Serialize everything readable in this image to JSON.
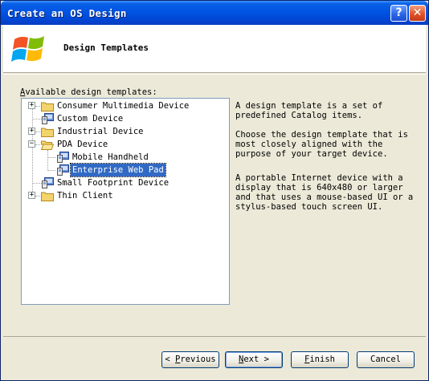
{
  "window": {
    "title": "Create an OS Design",
    "help_glyph": "?",
    "close_glyph": "✕"
  },
  "header": {
    "title": "Design Templates",
    "logo_icon": "windows-flag-icon"
  },
  "templates_label": {
    "accel": "A",
    "rest": "vailable design templates:"
  },
  "tree": {
    "items": [
      {
        "label": "Consumer Multimedia Device",
        "expander": "+",
        "icon": "folder-icon"
      },
      {
        "label": "Custom Device",
        "icon": "device-icon"
      },
      {
        "label": "Industrial Device",
        "expander": "+",
        "icon": "folder-icon"
      },
      {
        "label": "PDA Device",
        "expander": "−",
        "icon": "folder-open-icon"
      },
      {
        "label": "Mobile Handheld",
        "icon": "device-icon"
      },
      {
        "label": "Enterprise Web Pad",
        "icon": "device-icon",
        "selected": true
      },
      {
        "label": "Small Footprint Device",
        "icon": "device-icon"
      },
      {
        "label": "Thin Client",
        "expander": "+",
        "icon": "folder-icon"
      }
    ]
  },
  "description": {
    "p1": "A design template is a set of predefined Catalog items.",
    "p2": "Choose the design template that is most closely aligned with the purpose of your target device.",
    "p3": "A portable Internet device with a display that is 640x480 or larger and that uses a mouse-based UI or a stylus-based touch screen UI."
  },
  "buttons": {
    "previous": {
      "pre": "< ",
      "accel": "P",
      "rest": "revious"
    },
    "next": {
      "accel": "N",
      "rest": "ext >"
    },
    "finish": {
      "accel": "F",
      "rest": "inish"
    },
    "cancel": {
      "label": "Cancel"
    }
  },
  "colors": {
    "titlebar": "#0054e3",
    "selection": "#316ac5",
    "folder": "#f3d36b"
  }
}
